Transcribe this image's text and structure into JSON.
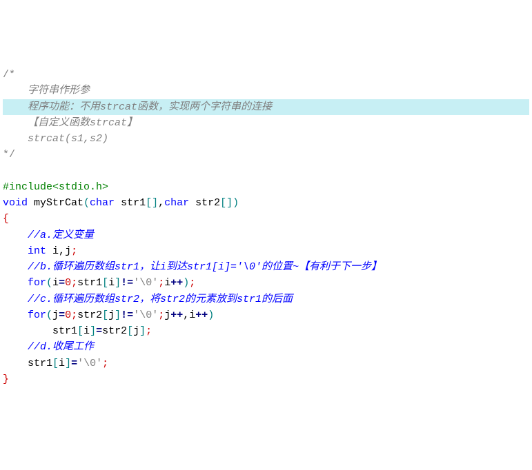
{
  "lines": {
    "l0": "/*",
    "l1a": "    ",
    "l1b": "字符串作形参",
    "l2a": "    ",
    "l2b": "程序功能：不用strcat函数，实现两个字符串的连接",
    "l3a": "    ",
    "l3b": "【自定义函数strcat】",
    "l4a": "    ",
    "l4b": "strcat(s1,s2)",
    "l5": "*/",
    "blank1": " ",
    "inc1": "#include",
    "inc2": "<stdio.h>",
    "fn_void": "void",
    "fn_name": " myStrCat",
    "fn_p1": "(",
    "fn_char1": "char",
    "fn_arg1": " str1",
    "fn_br1": "[]",
    "fn_comma": ",",
    "fn_char2": "char",
    "fn_arg2": " str2",
    "fn_br2": "[]",
    "fn_p2": ")",
    "ob": "{",
    "ca_i": "    ",
    "ca": "//a.定义变量",
    "int_i": "    ",
    "int_kw": "int",
    "int_rest": " i",
    "int_comma": ",",
    "int_j": "j",
    "int_semi": ";",
    "cb_i": "    ",
    "cb": "//b.循环遍历数组str1，让i到达str1[i]='\\0'的位置~【有利于下一步】",
    "for1_i": "    ",
    "for1_for": "for",
    "for1_p1": "(",
    "for1_a": "i",
    "for1_eq1": "=",
    "for1_z": "0",
    "for1_s1": ";",
    "for1_b1": "str1",
    "for1_br1": "[",
    "for1_ix": "i",
    "for1_br2": "]",
    "for1_ne": "!=",
    "for1_q": "'\\0'",
    "for1_s2": ";",
    "for1_c": "i",
    "for1_pp": "++",
    "for1_p2": ")",
    "for1_s3": ";",
    "cc_i": "    ",
    "cc": "//c.循环遍历数组str2，将str2的元素放到str1的后面",
    "for2_i": "    ",
    "for2_for": "for",
    "for2_p1": "(",
    "for2_a": "j",
    "for2_eq1": "=",
    "for2_z": "0",
    "for2_s1": ";",
    "for2_b1": "str2",
    "for2_br1": "[",
    "for2_jx": "j",
    "for2_br2": "]",
    "for2_ne": "!=",
    "for2_q": "'\\0'",
    "for2_s2": ";",
    "for2_j2": "j",
    "for2_pp1": "++",
    "for2_cm": ",",
    "for2_i2": "i",
    "for2_pp2": "++",
    "for2_p2": ")",
    "body_i": "        ",
    "body_s1": "str1",
    "body_br1": "[",
    "body_ix": "i",
    "body_br2": "]",
    "body_eq": "=",
    "body_s2": "str2",
    "body_br3": "[",
    "body_jx": "j",
    "body_br4": "]",
    "body_semi": ";",
    "cd_i": "    ",
    "cd": "//d.收尾工作",
    "last_i": "    ",
    "last_s1": "str1",
    "last_br1": "[",
    "last_ix": "i",
    "last_br2": "]",
    "last_eq": "=",
    "last_q": "'\\0'",
    "last_semi": ";",
    "cb2": "}"
  }
}
